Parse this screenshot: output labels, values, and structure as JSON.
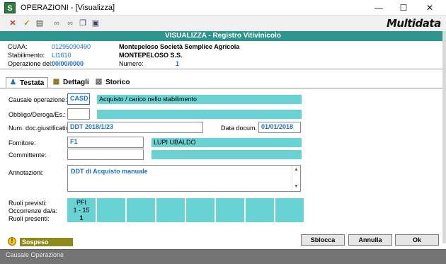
{
  "window": {
    "title": "OPERAZIONI - [Visualizza]",
    "minimize": "—",
    "maximize": "☐",
    "close": "✕"
  },
  "toolbar": {
    "logo": "Multidata",
    "icons": [
      "cancel-icon",
      "confirm-icon",
      "book-icon",
      "binoculars-icon",
      "binoculars-x-icon",
      "copy-icon",
      "paste-icon"
    ]
  },
  "banner": {
    "title": "VISUALIZZA - Registro Vitivinicolo"
  },
  "header": {
    "cuaa_label": "CUAA:",
    "cuaa_code": "01295090490",
    "cuaa_name": "Montepeloso Società Semplice Agricola",
    "stab_label": "Stabilimento:",
    "stab_code": "LI1610",
    "stab_name": "MONTEPELOSO S.S.",
    "op_label": "Operazione del:",
    "op_date": "00/00/0000",
    "num_label": "Numero:",
    "num_value": "1"
  },
  "tabs": [
    {
      "label": "Testata",
      "active": true
    },
    {
      "label": "Dettagli",
      "active": false
    },
    {
      "label": "Storico",
      "active": false
    }
  ],
  "form": {
    "causale_label": "Causale operazione:",
    "causale_code": "CASD",
    "causale_desc": "Acquisto / carico nello stabilimento",
    "obbligo_label": "Obbligo/Deroga/Es.:",
    "obbligo_code": "",
    "obbligo_desc": "",
    "doc_label": "Num. doc.giustificativo:",
    "doc_value": "DDT 2018/1/23",
    "data_doc_label": "Data docum.",
    "data_doc_value": "01/01/2018",
    "fornitore_label": "Fornitore:",
    "fornitore_code": "F1",
    "fornitore_name": "LUPI UBALDO",
    "committente_label": "Committente:",
    "committente_code": "",
    "committente_name": "",
    "annotazioni_label": "Annotazioni:",
    "annotazioni_value": "DDT di Acquisto manuale"
  },
  "roles": {
    "previsti_label": "Ruoli previsti:",
    "occorrenze_label": "Occorrenze da/a:",
    "presenti_label": "Ruoli presenti:",
    "first_role": {
      "name": "PFI",
      "range": "1 - 15",
      "present": "1"
    }
  },
  "buttons": {
    "sblocca": "Sblocca",
    "annulla": "Annulla",
    "ok": "Ok"
  },
  "status": {
    "badge": "Sospeso",
    "warning_glyph": "!",
    "bar_text": "Causale Operazione"
  },
  "colors": {
    "teal_banner": "#2e948e",
    "teal_field": "#69d3d3",
    "value_blue": "#1c6fc8",
    "suspended": "#8d8a1c"
  }
}
